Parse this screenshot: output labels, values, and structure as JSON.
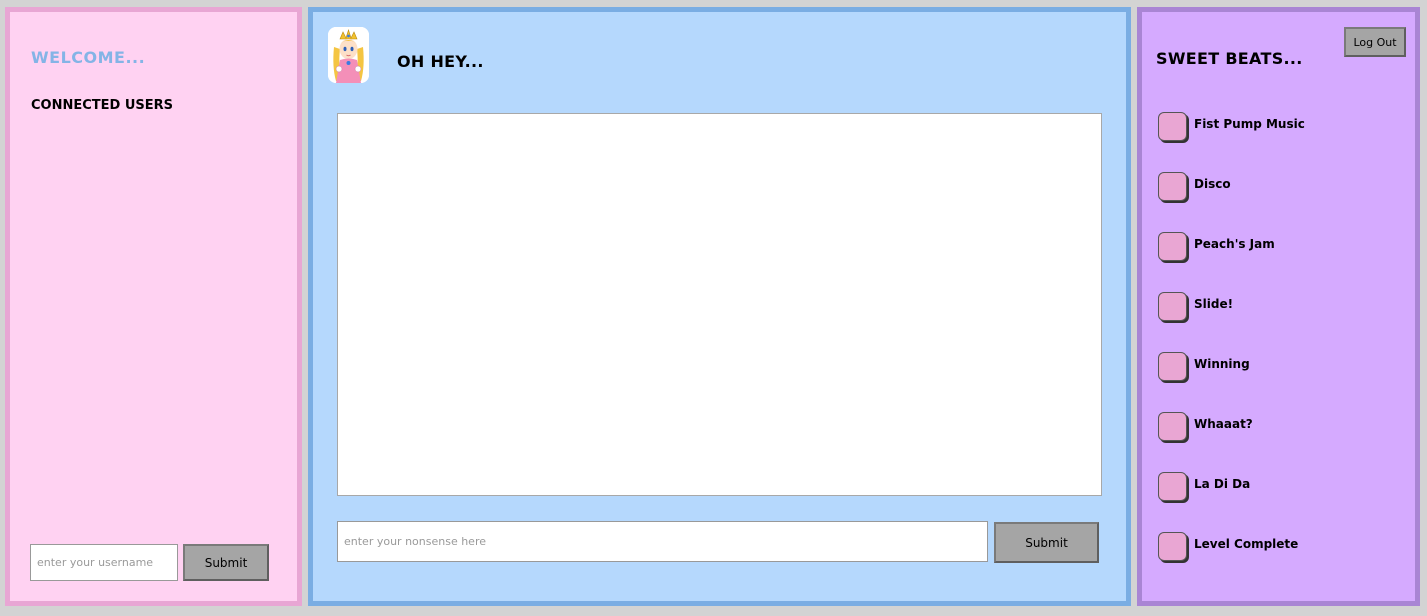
{
  "left": {
    "welcome": "WELCOME...",
    "connected_users_label": "CONNECTED USERS",
    "username_placeholder": "enter your username",
    "username_value": "",
    "submit_label": "Submit"
  },
  "middle": {
    "avatar_icon": "princess-peach-icon",
    "heading": "OH HEY...",
    "message_placeholder": "enter your nonsense here",
    "message_value": "",
    "submit_label": "Submit"
  },
  "right": {
    "heading": "SWEET BEATS...",
    "logout_label": "Log Out",
    "beats": [
      {
        "label": "Fist Pump Music"
      },
      {
        "label": "Disco"
      },
      {
        "label": "Peach's Jam"
      },
      {
        "label": "Slide!"
      },
      {
        "label": "Winning"
      },
      {
        "label": "Whaaat?"
      },
      {
        "label": "La Di Da"
      },
      {
        "label": "Level Complete"
      }
    ]
  },
  "colors": {
    "background": "#d3d3d3",
    "left_panel": "#ffd2f2",
    "left_border": "#e8a6d4",
    "middle_panel": "#b5d8fd",
    "middle_border": "#7aade3",
    "right_panel": "#d5aaff",
    "right_border": "#a985d4",
    "welcome_text": "#84b4e6",
    "beat_button": "#e9a6d3",
    "gray_button": "#a5a5a5"
  }
}
